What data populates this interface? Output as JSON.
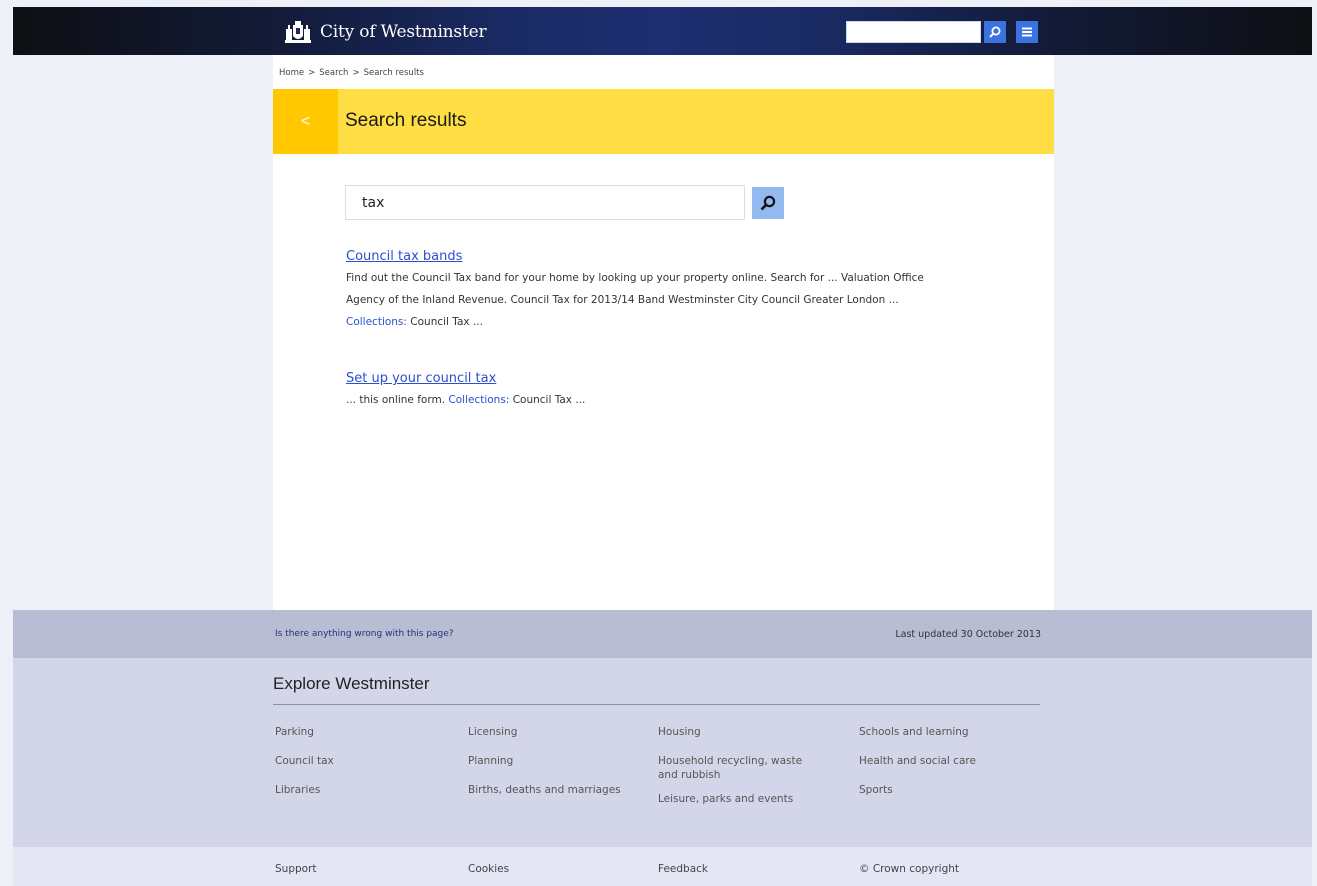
{
  "header": {
    "brand_name": "City of Westminster",
    "crest_icon": "westminster-crest-icon",
    "search_placeholder": "",
    "search_icon": "search-icon",
    "menu_icon": "menu-icon"
  },
  "breadcrumb": {
    "items": [
      "Home",
      ">",
      "Search",
      ">",
      "Search results"
    ]
  },
  "banner": {
    "back_symbol": "<",
    "title": "Search results",
    "color": "#ffdd44",
    "tab_color": "#ffc800"
  },
  "search": {
    "value": "tax"
  },
  "results": [
    {
      "title": "Council tax bands",
      "lines": [
        "Find out the Council Tax band for your home by looking up your property online. Search for ... Valuation Office",
        "Agency of the Inland Revenue. Council Tax for 2013/14 Band Westminster City Council Greater London ..."
      ],
      "collections_label": "Collections:",
      "collections_value": "Council Tax ..."
    },
    {
      "title": "Set up your council tax",
      "prefix": "... this online form.",
      "collections_label": "Collections:",
      "collections_value": "Council Tax ..."
    }
  ],
  "footer": {
    "wrong_link": "Is there anything wrong with this page?",
    "last_updated": "Last updated  30 October 2013",
    "explore_title": "Explore Westminster",
    "columns": [
      [
        "Parking",
        "Council tax",
        "Libraries"
      ],
      [
        "Licensing",
        "Planning",
        "Births, deaths and marriages"
      ],
      [
        "Housing",
        "Household recycling, waste and rubbish",
        "Leisure, parks and events"
      ],
      [
        "Schools and learning",
        "Health and social care",
        "Sports"
      ]
    ],
    "bottom": [
      "Support",
      "Cookies",
      "Feedback",
      "© Crown copyright"
    ]
  }
}
